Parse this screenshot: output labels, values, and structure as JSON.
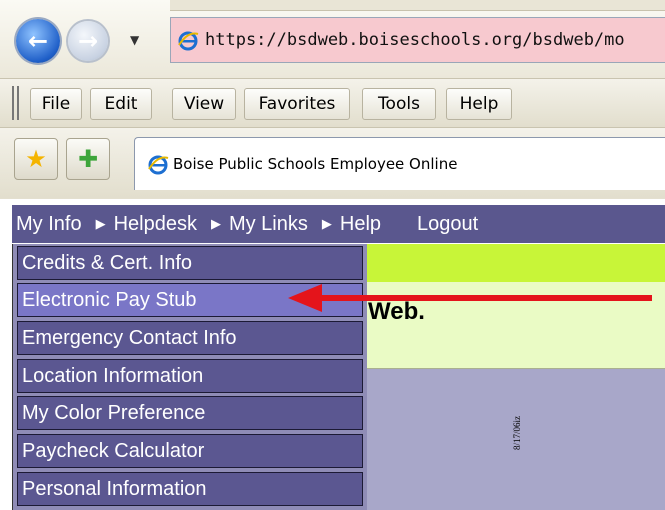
{
  "browser": {
    "address": "https://bsdweb.boiseschools.org/bsdweb/mo",
    "menu": [
      "File",
      "Edit",
      "View",
      "Favorites",
      "Tools",
      "Help"
    ],
    "tab_title": "Boise Public Schools Employee Online"
  },
  "navbar": {
    "items": [
      "My Info",
      "Helpdesk",
      "My Links",
      "Help",
      "Logout"
    ]
  },
  "dropdown": {
    "items": [
      "Credits & Cert. Info",
      "Electronic Pay Stub",
      "Emergency Contact Info",
      "Location Information",
      "My Color Preference",
      "Paycheck Calculator",
      "Personal Information"
    ],
    "highlighted": "Electronic Pay Stub"
  },
  "content": {
    "partial_text": "Web.",
    "stamp": "8/17/06iz"
  },
  "colors": {
    "navbar_bg": "#5a578e",
    "dropdown_item_bg": "#5b5791",
    "dropdown_active_bg": "#7a76c7",
    "content_green": "#c8f538",
    "content_pale": "#eafbc5",
    "arrow": "#e4141b",
    "address_bg": "#f7c9cf"
  }
}
